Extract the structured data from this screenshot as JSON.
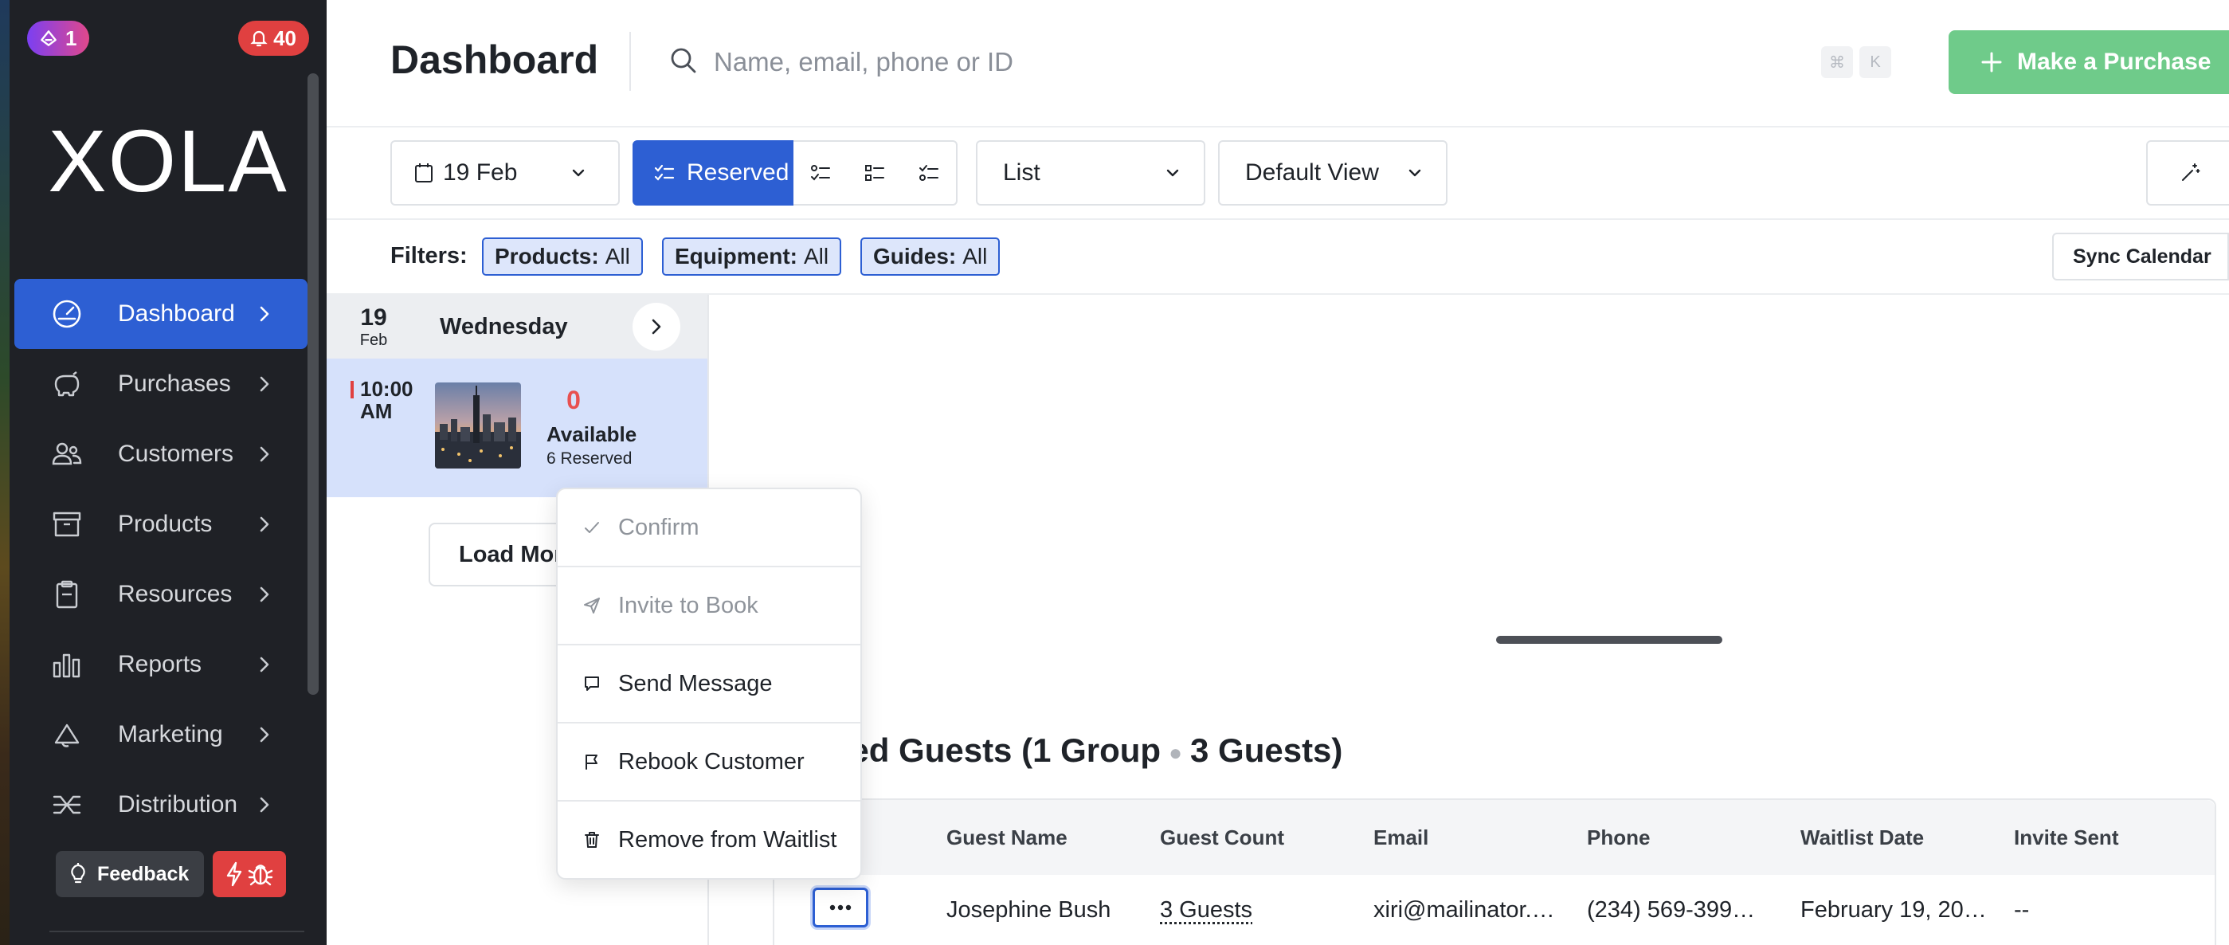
{
  "sidebar": {
    "ai_badge_count": "1",
    "notification_count": "40",
    "logo_text": "XOLA",
    "items": [
      {
        "label": "Dashboard",
        "icon": "gauge-icon",
        "active": true
      },
      {
        "label": "Purchases",
        "icon": "piggy-bank-icon"
      },
      {
        "label": "Customers",
        "icon": "users-icon"
      },
      {
        "label": "Products",
        "icon": "archive-box-icon"
      },
      {
        "label": "Resources",
        "icon": "clipboard-icon"
      },
      {
        "label": "Reports",
        "icon": "bar-chart-icon"
      },
      {
        "label": "Marketing",
        "icon": "megaphone-icon"
      },
      {
        "label": "Distribution",
        "icon": "distribution-icon"
      }
    ],
    "feedback_label": "Feedback"
  },
  "header": {
    "title": "Dashboard",
    "search_placeholder": "Name, email, phone or ID",
    "shortcut_keys": [
      "⌘",
      "K"
    ],
    "purchase_label": "Make a Purchase"
  },
  "toolbar": {
    "date_label": "19 Feb",
    "reserved_label": "Reserved",
    "list_label": "List",
    "view_label": "Default View"
  },
  "filters": {
    "label": "Filters:",
    "chips": [
      {
        "key": "Products:",
        "value": "All"
      },
      {
        "key": "Equipment:",
        "value": "All"
      },
      {
        "key": "Guides:",
        "value": "All"
      }
    ],
    "sync_label": "Sync Calendar"
  },
  "schedule": {
    "day_num": "19",
    "day_month": "Feb",
    "day_name": "Wednesday",
    "slot": {
      "time_line1": "10:00",
      "time_line2": "AM",
      "available_count": "0",
      "available_label": "Available",
      "reserved_label": "6 Reserved"
    },
    "load_more_label": "Load More"
  },
  "waitlist": {
    "title_partial": "sted Guests (1 Group",
    "title_guests": "3 Guests)",
    "columns": [
      "Guest Name",
      "Guest Count",
      "Email",
      "Phone",
      "Waitlist Date",
      "Invite Sent"
    ],
    "row": {
      "guest_name": "Josephine Bush",
      "guest_count": "3 Guests",
      "email": "xiri@mailinator.…",
      "phone": "(234) 569-399…",
      "waitlist_date": "February 19, 20…",
      "invite_sent": "--"
    }
  },
  "context_menu": {
    "items": [
      {
        "label": "Confirm",
        "icon": "check-icon",
        "disabled": true
      },
      {
        "label": "Invite to Book",
        "icon": "send-icon",
        "disabled": true
      },
      {
        "label": "Send Message",
        "icon": "message-icon",
        "disabled": false
      },
      {
        "label": "Rebook Customer",
        "icon": "flag-icon",
        "disabled": false
      },
      {
        "label": "Remove from Waitlist",
        "icon": "trash-icon",
        "disabled": false
      }
    ]
  },
  "colors": {
    "primary": "#2d5fd3",
    "sidebar_bg": "#1f2126",
    "purchase_green": "#6fcb8a",
    "alert_red": "#e04040"
  }
}
